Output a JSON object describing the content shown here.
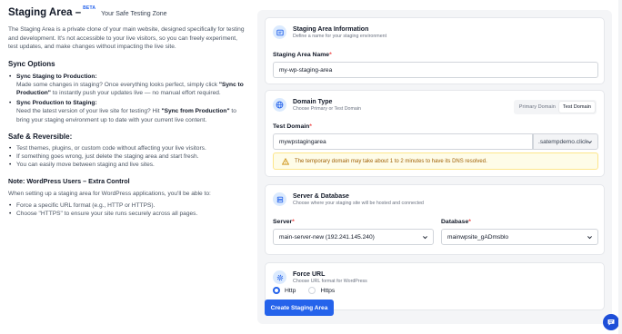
{
  "header": {
    "title": "Staging Area –",
    "beta": "BETA",
    "subtitle": "Your Safe Testing Zone"
  },
  "intro": "The Staging Area is a private clone of your main website, designed specifically for testing and development. It's not accessible to your live visitors, so you can freely experiment, test updates, and make changes without impacting the live site.",
  "sync": {
    "heading": "Sync Options",
    "items": [
      {
        "title": "Sync Staging to Production:",
        "pre": "Made some changes in staging? Once everything looks perfect, simply click ",
        "bold": "\"Sync to Production\"",
        "post": " to instantly push your updates live — no manual effort required."
      },
      {
        "title": "Sync Production to Staging:",
        "pre": "Need the latest version of your live site for testing? Hit ",
        "bold": "\"Sync from Production\"",
        "post": " to bring your staging environment up to date with your current live content."
      }
    ]
  },
  "safe": {
    "heading": "Safe & Reversible:",
    "items": [
      "Test themes, plugins, or custom code without affecting your live visitors.",
      "If something goes wrong, just delete the staging area and start fresh.",
      "You can easily move between staging and live sites."
    ]
  },
  "note": {
    "heading": "Note: WordPress Users – Extra Control",
    "text": "When setting up a staging area for WordPress applications, you'll be able to:",
    "items": [
      "Force a specific URL format (e.g., HTTP or HTTPS).",
      "Choose \"HTTPS\" to ensure your site runs securely across all pages."
    ]
  },
  "info_card": {
    "title": "Staging Area Information",
    "subtitle": "Define a name for your staging environment",
    "name_label": "Staging Area Name",
    "name_value": "my-wp-staging-area"
  },
  "domain_card": {
    "title": "Domain Type",
    "subtitle": "Choose Primary or Test Domain",
    "toggle_primary": "Primary Domain",
    "toggle_test": "Test Domain",
    "test_domain_label": "Test Domain",
    "test_domain_value": "mywpstagingarea",
    "suffix": ".satempdemo.click",
    "warning": "The temporary domain may take about 1 to 2 minutes to have its DNS resolved."
  },
  "server_card": {
    "title": "Server & Database",
    "subtitle": "Choose where your staging site will be hosted and connected",
    "server_label": "Server",
    "server_value": "main-server-new (192.241.145.240)",
    "db_label": "Database",
    "db_value": "mainwpsite_gADmsblo"
  },
  "url_card": {
    "title": "Force URL",
    "subtitle": "Choose URL format for WordPress",
    "options": [
      "Http",
      "Https"
    ],
    "selected": "Http"
  },
  "submit_label": "Create Staging Area",
  "required_mark": "*",
  "colors": {
    "accent": "#2563eb",
    "warning_bg": "#fefce8",
    "warning_text": "#a16207"
  }
}
